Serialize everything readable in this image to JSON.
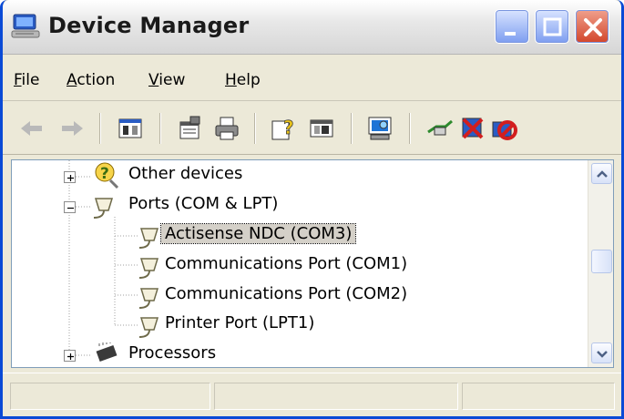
{
  "window": {
    "title": "Device Manager",
    "colors": {
      "frame": "#0a4ad6",
      "close": "#d2452b",
      "selection": "#d4d0c8"
    }
  },
  "menu": {
    "items": [
      {
        "label": "File",
        "accel": "F",
        "rest": "ile"
      },
      {
        "label": "Action",
        "accel": "A",
        "rest": "ction"
      },
      {
        "label": "View",
        "accel": "V",
        "rest": "iew"
      },
      {
        "label": "Help",
        "accel": "H",
        "rest": "elp"
      }
    ]
  },
  "toolbar": {
    "icons": [
      "back-arrow-icon",
      "forward-arrow-icon",
      "show-hide-console-tree-icon",
      "properties-icon",
      "print-icon",
      "help-icon",
      "show-hide-action-pane-icon",
      "scan-hardware-icon",
      "update-driver-icon",
      "uninstall-icon",
      "disable-icon"
    ]
  },
  "tree": {
    "rows": [
      {
        "label": "Other devices",
        "icon": "unknown-device-icon",
        "expander": "+"
      },
      {
        "label": "Ports (COM & LPT)",
        "icon": "port-icon",
        "expander": "-"
      },
      {
        "label": "Actisense NDC (COM3)",
        "icon": "port-icon",
        "selected": true
      },
      {
        "label": "Communications Port (COM1)",
        "icon": "port-icon"
      },
      {
        "label": "Communications Port (COM2)",
        "icon": "port-icon"
      },
      {
        "label": "Printer Port (LPT1)",
        "icon": "port-icon"
      },
      {
        "label": "Processors",
        "icon": "processor-icon",
        "expander": "+"
      }
    ]
  },
  "statusbar": {
    "panes": [
      "",
      "",
      ""
    ]
  }
}
